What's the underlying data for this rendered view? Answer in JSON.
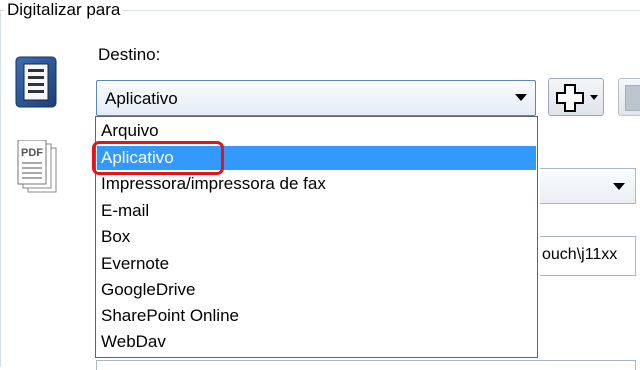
{
  "group": {
    "title": "Digitalizar para"
  },
  "destination": {
    "label": "Destino:",
    "selected": "Aplicativo",
    "options": [
      "Arquivo",
      "Aplicativo",
      "Impressora/impressora de fax",
      "E-mail",
      "Box",
      "Evernote",
      "GoogleDrive",
      "SharePoint Online",
      "WebDav"
    ],
    "highlighted_index": 1
  },
  "background": {
    "path_text": "ouch\\j11xx"
  },
  "icons": {
    "app": "application-icon",
    "pdf": "pdf-document-icon",
    "add": "add-plus-icon"
  },
  "colors": {
    "selection": "#3399ff",
    "highlight_circle": "#e0161b"
  }
}
